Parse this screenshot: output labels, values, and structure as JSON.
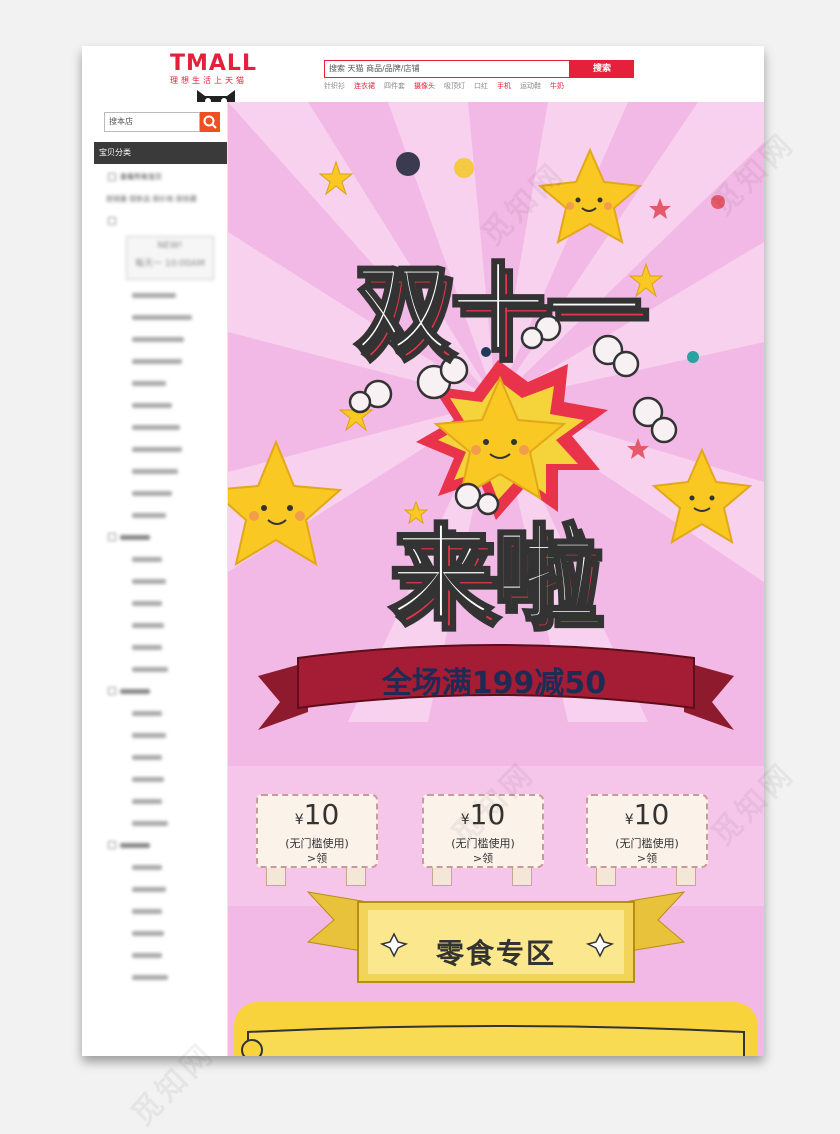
{
  "header": {
    "logo_text": "TMALL",
    "logo_slogan": "理想生活上天猫",
    "search_placeholder": "搜索 天猫 商品/品牌/店铺",
    "search_button": "搜索",
    "hot_words": [
      {
        "label": "针织衫",
        "highlight": false
      },
      {
        "label": "连衣裙",
        "highlight": true
      },
      {
        "label": "四件套",
        "highlight": false
      },
      {
        "label": "摄像头",
        "highlight": true
      },
      {
        "label": "吸顶灯",
        "highlight": false
      },
      {
        "label": "口红",
        "highlight": false
      },
      {
        "label": "手机",
        "highlight": true
      },
      {
        "label": "运动鞋",
        "highlight": false
      },
      {
        "label": "牛奶",
        "highlight": true
      }
    ]
  },
  "sidebar": {
    "search_placeholder": "搜本店",
    "category_bar": "宝贝分类",
    "first_group": "查看所有宝贝",
    "first_group_sub": "按销量 按新品 按价格 按收藏",
    "new_badge_line1": "NEW!",
    "new_badge_line2": "每天一 10:00AM"
  },
  "banner": {
    "headline_line1": "双十一",
    "headline_line2": "来啦",
    "promo": "全场满199减50",
    "coupons": [
      {
        "currency": "¥",
        "amount": "10",
        "condition": "(无门槛使用)",
        "action": ">领"
      },
      {
        "currency": "¥",
        "amount": "10",
        "condition": "(无门槛使用)",
        "action": ">领"
      },
      {
        "currency": "¥",
        "amount": "10",
        "condition": "(无门槛使用)",
        "action": ">领"
      }
    ],
    "section_title": "零食专区"
  },
  "watermark": "觅知网",
  "colors": {
    "tmall_red": "#e5203b",
    "banner_pink": "#f3b9e6",
    "star_yellow": "#f9c823",
    "ribbon_red": "#a51d35",
    "promo_navy": "#1f2b55",
    "gold": "#e8c23a"
  }
}
